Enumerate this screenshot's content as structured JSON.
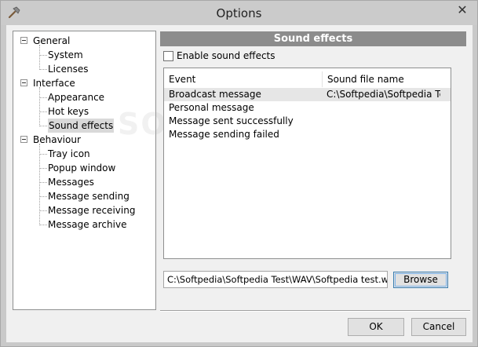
{
  "window": {
    "title": "Options",
    "close_glyph": "✕",
    "app_icon": "hammer-icon"
  },
  "tree": [
    {
      "label": "General",
      "expanded": true,
      "children": [
        {
          "label": "System"
        },
        {
          "label": "Licenses"
        }
      ]
    },
    {
      "label": "Interface",
      "expanded": true,
      "children": [
        {
          "label": "Appearance"
        },
        {
          "label": "Hot keys"
        },
        {
          "label": "Sound effects",
          "selected": true
        }
      ]
    },
    {
      "label": "Behaviour",
      "expanded": true,
      "children": [
        {
          "label": "Tray icon"
        },
        {
          "label": "Popup window"
        },
        {
          "label": "Messages"
        },
        {
          "label": "Message sending"
        },
        {
          "label": "Message receiving"
        },
        {
          "label": "Message archive"
        }
      ]
    }
  ],
  "panel": {
    "header": "Sound effects",
    "enable_label": "Enable sound effects",
    "enable_checked": false,
    "list": {
      "columns": [
        "Event",
        "Sound file name"
      ],
      "rows": [
        {
          "event": "Broadcast message",
          "file": "C:\\Softpedia\\Softpedia Tes...",
          "selected": true
        },
        {
          "event": "Personal message",
          "file": ""
        },
        {
          "event": "Message sent successfully",
          "file": ""
        },
        {
          "event": "Message sending failed",
          "file": ""
        }
      ]
    },
    "path_value": "C:\\Softpedia\\Softpedia Test\\WAV\\Softpedia test.wav",
    "browse_label": "Browse"
  },
  "buttons": {
    "ok": "OK",
    "cancel": "Cancel"
  },
  "watermark": "SOFTPEDIA"
}
